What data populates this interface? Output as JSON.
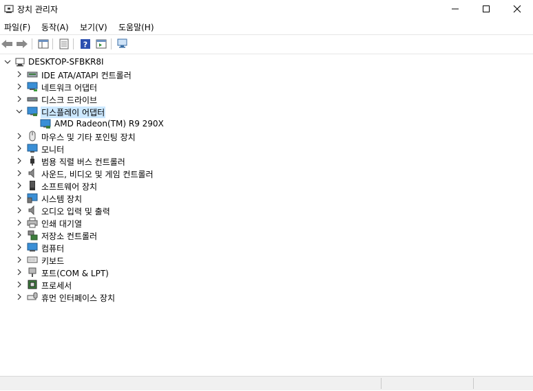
{
  "window": {
    "title": "장치 관리자",
    "minimize_icon": "minimize-icon",
    "maximize_icon": "maximize-icon",
    "close_icon": "close-icon"
  },
  "menu": [
    "파일(F)",
    "동작(A)",
    "보기(V)",
    "도움말(H)"
  ],
  "toolbar": {
    "buttons": [
      "back-arrow-icon",
      "forward-arrow-icon",
      "show-hide-console-tree-icon",
      "properties-icon",
      "help-icon",
      "view-icon",
      "scan-hardware-icon"
    ]
  },
  "tree": {
    "root": "DESKTOP-SFBKR8I",
    "nodes": [
      {
        "label": "IDE ATA/ATAPI 컨트롤러",
        "icon": "ide-controller-icon",
        "expanded": false
      },
      {
        "label": "네트워크 어댑터",
        "icon": "network-adapter-icon",
        "expanded": false
      },
      {
        "label": "디스크 드라이브",
        "icon": "disk-drive-icon",
        "expanded": false
      },
      {
        "label": "디스플레이 어댑터",
        "icon": "display-adapter-icon",
        "expanded": true,
        "selected": true
      },
      {
        "label": "AMD Radeon(TM) R9 290X",
        "icon": "gpu-device-icon",
        "child": true
      },
      {
        "label": "마우스 및 기타 포인팅 장치",
        "icon": "mouse-icon",
        "expanded": false
      },
      {
        "label": "모니터",
        "icon": "monitor-icon",
        "expanded": false
      },
      {
        "label": "범용 직렬 버스 컨트롤러",
        "icon": "usb-controller-icon",
        "expanded": false
      },
      {
        "label": "사운드, 비디오 및 게임 컨트롤러",
        "icon": "speaker-icon",
        "expanded": false
      },
      {
        "label": "소프트웨어 장치",
        "icon": "software-device-icon",
        "expanded": false
      },
      {
        "label": "시스템 장치",
        "icon": "system-device-icon",
        "expanded": false
      },
      {
        "label": "오디오 입력 및 출력",
        "icon": "audio-io-icon",
        "expanded": false
      },
      {
        "label": "인쇄 대기열",
        "icon": "printer-icon",
        "expanded": false
      },
      {
        "label": "저장소 컨트롤러",
        "icon": "storage-controller-icon",
        "expanded": false
      },
      {
        "label": "컴퓨터",
        "icon": "computer-icon",
        "expanded": false
      },
      {
        "label": "키보드",
        "icon": "keyboard-icon",
        "expanded": false
      },
      {
        "label": "포트(COM & LPT)",
        "icon": "port-icon",
        "expanded": false
      },
      {
        "label": "프로세서",
        "icon": "processor-icon",
        "expanded": false
      },
      {
        "label": "휴먼 인터페이스 장치",
        "icon": "hid-icon",
        "expanded": false
      }
    ]
  },
  "colors": {
    "selection": "#cce8ff",
    "statusbar": "#f0f0f0"
  }
}
